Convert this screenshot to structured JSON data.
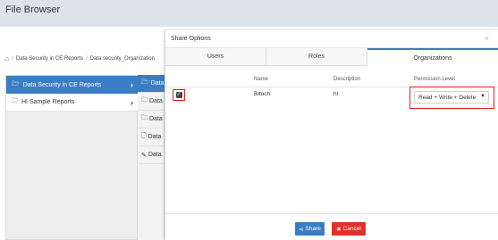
{
  "app": {
    "title": "File Browser"
  },
  "breadcrumb": {
    "items": [
      "Data Security in CE Reports",
      "Data security_Organization"
    ]
  },
  "tree": {
    "items": [
      {
        "label": "Data Security in CE Reports",
        "icon": "folder-open-icon"
      },
      {
        "label": "HI Sample Reports",
        "icon": "folder-icon"
      }
    ]
  },
  "middle": {
    "items": [
      {
        "label": "Data",
        "icon": "folder-open-icon"
      },
      {
        "label": "Data",
        "icon": "folder-icon"
      },
      {
        "label": "Data",
        "icon": "folder-icon"
      },
      {
        "label": "Data",
        "icon": "file-icon"
      },
      {
        "label": "Data",
        "icon": "pencil-icon"
      }
    ]
  },
  "modal": {
    "title": "Share Options",
    "close": "×",
    "tabs": [
      "Users",
      "Roles",
      "Organizations"
    ],
    "active_tab": "Organizations",
    "columns": {
      "name": "Name",
      "description": "Description",
      "permission": "Permission Level"
    },
    "row": {
      "checked": true,
      "name": "Bitoch",
      "description": "hi",
      "permission": "Read + Write + Delete"
    },
    "share_label": "Share",
    "cancel_label": "Cancel"
  },
  "colors": {
    "accent": "#3b7dc4",
    "danger": "#e0312b",
    "highlight": "#e02020"
  }
}
